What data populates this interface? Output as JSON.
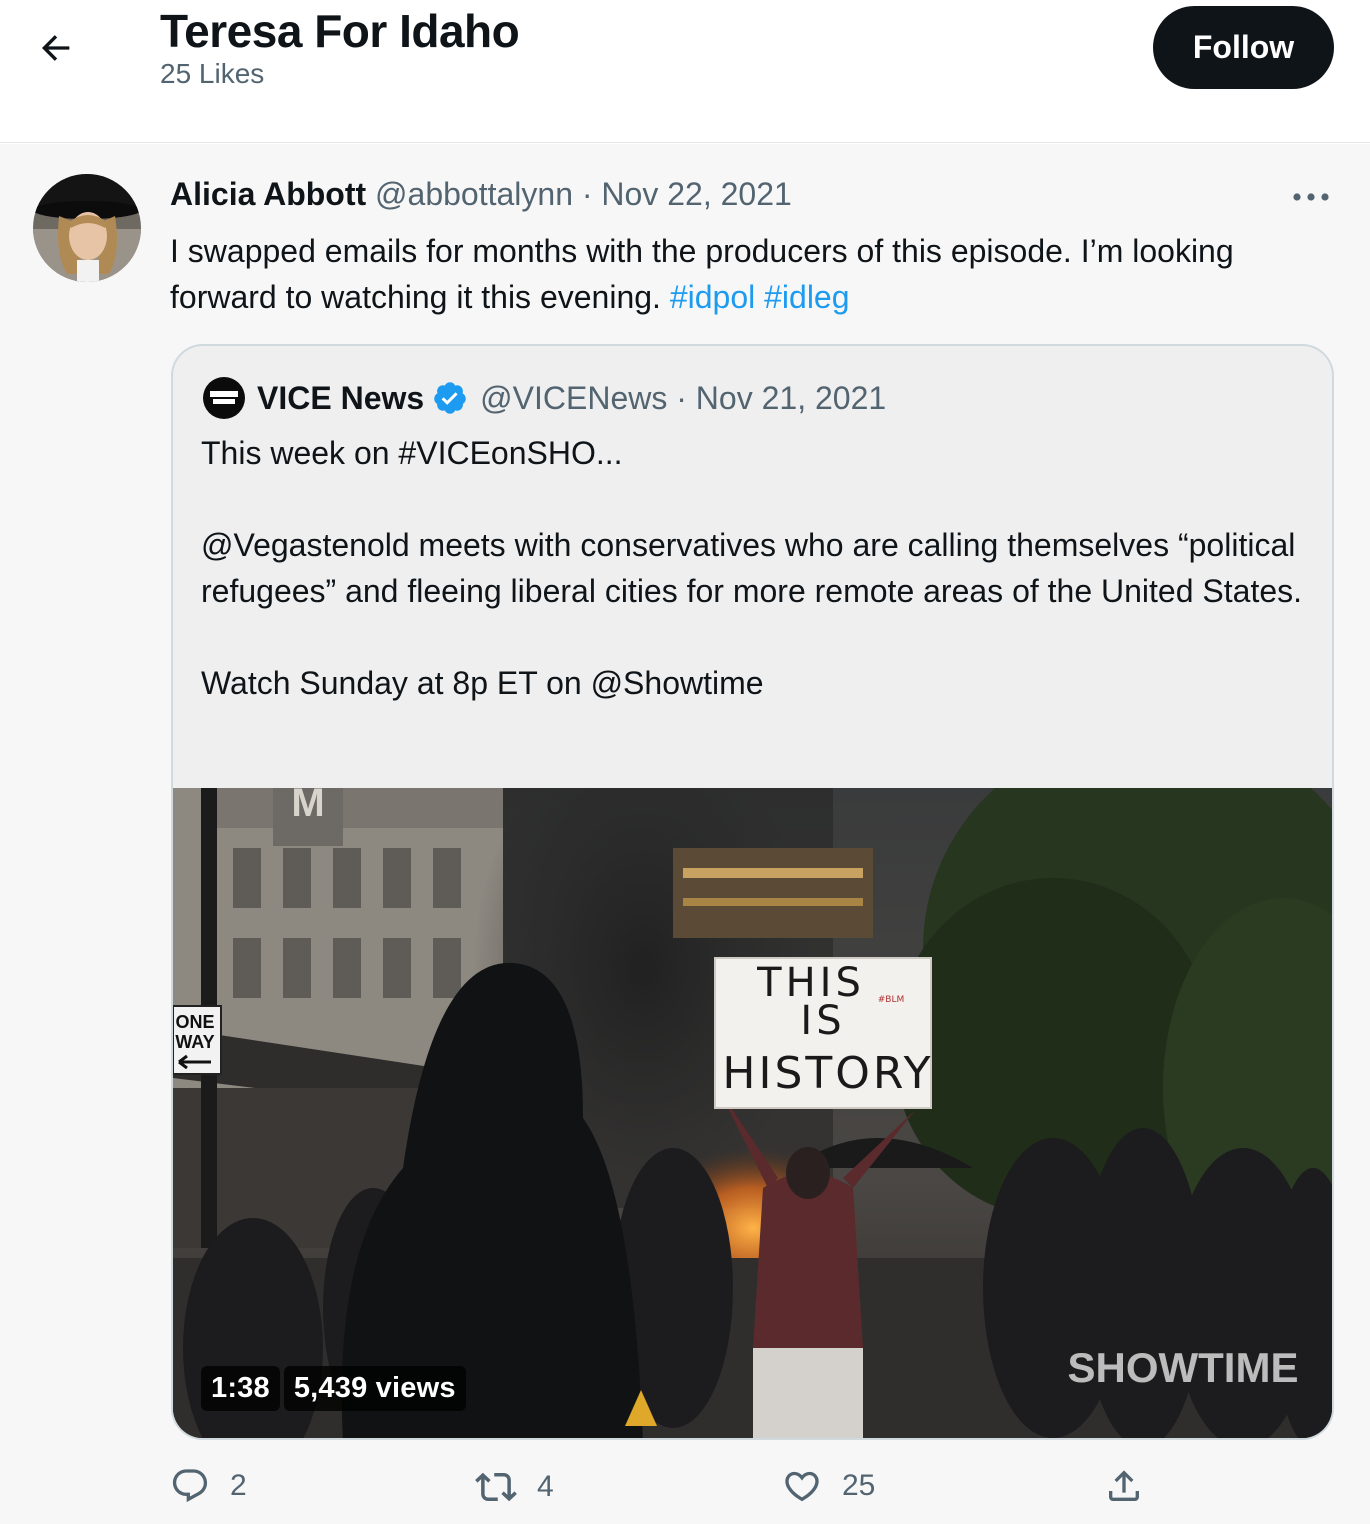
{
  "header": {
    "title": "Teresa For Idaho",
    "subtitle": "25 Likes",
    "follow_label": "Follow"
  },
  "tweet": {
    "author_name": "Alicia Abbott",
    "handle": "@abbottalynn",
    "separator": "·",
    "date": "Nov 22, 2021",
    "text": "I swapped emails for months with the producers of this episode. I’m looking forward to watching it this evening.",
    "hashtags": [
      "#idpol",
      "#idleg"
    ]
  },
  "quoted": {
    "name": "VICE News",
    "handle": "@VICENews",
    "separator": "·",
    "date": "Nov 21, 2021",
    "paragraphs": [
      "This week on #VICEonSHO...",
      "@Vegastenold meets with conservatives who are calling themselves “political refugees” and fleeing liberal cities for more remote areas of the United States.",
      "Watch Sunday at 8p ET on @Showtime"
    ],
    "video": {
      "duration": "1:38",
      "views": "5,439 views",
      "sign_lines": [
        "THIS",
        "IS",
        "HISTORY"
      ],
      "sign_tag": "#BLM",
      "street_sign_lines": [
        "ONE",
        "WAY"
      ],
      "building_letter": "M",
      "watermark": "SHOWTIME"
    }
  },
  "actions": {
    "replies": "2",
    "retweets": "4",
    "likes": "25"
  },
  "icons": {
    "back": "arrow-left-icon",
    "more": "more-icon",
    "reply": "reply-icon",
    "retweet": "retweet-icon",
    "like": "heart-icon",
    "share": "share-icon",
    "verified": "verified-badge-icon"
  },
  "colors": {
    "accent": "#1d9bf0",
    "text": "#0f1419",
    "muted": "#536471",
    "follow_bg": "#0f1419"
  }
}
